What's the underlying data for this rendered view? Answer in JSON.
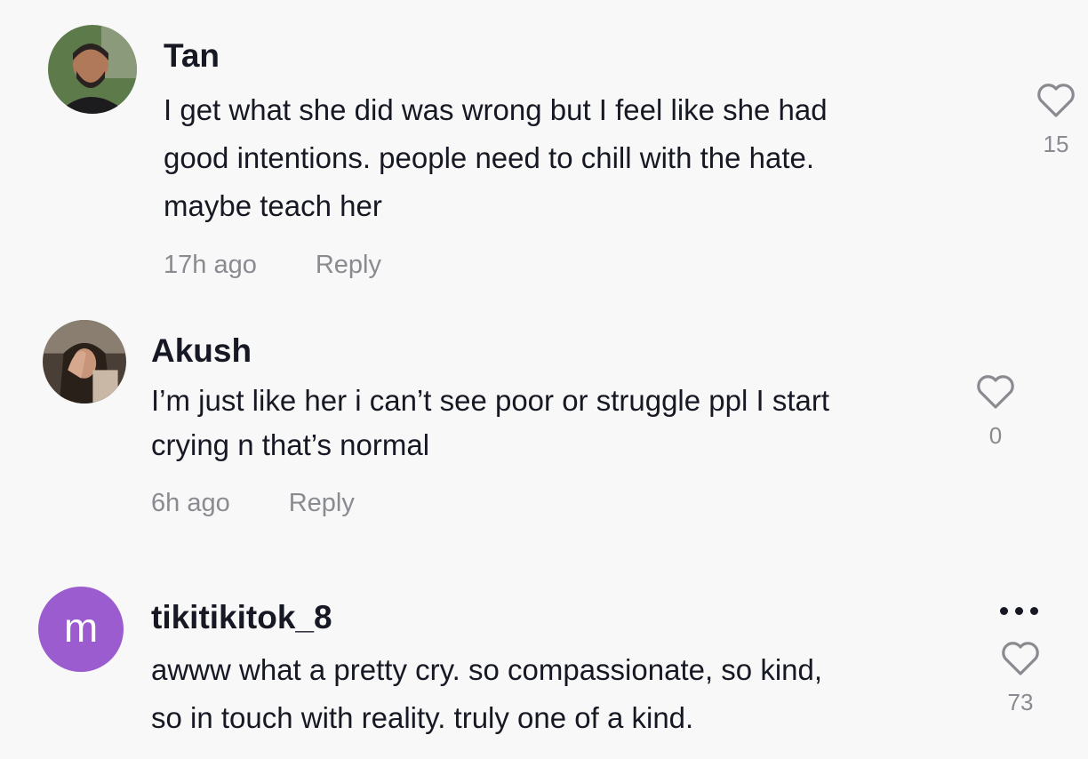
{
  "comments": [
    {
      "username": "Tan",
      "lines": [
        "I get what she did was wrong but I feel like she had",
        "good intentions. people need to chill with the hate.",
        "maybe teach her"
      ],
      "time": "17h ago",
      "reply_label": "Reply",
      "likes": "15",
      "avatar_icon": "profile-photo"
    },
    {
      "username": "Akush",
      "lines": [
        "I’m just like her i can’t see poor or struggle ppl I start",
        "crying n that’s normal"
      ],
      "time": "6h ago",
      "reply_label": "Reply",
      "likes": "0",
      "avatar_icon": "profile-photo"
    },
    {
      "username": "tikitikitok_8",
      "avatar_letter": "m",
      "avatar_color": "#9a5ccf",
      "lines": [
        "awww what a pretty cry. so compassionate, so kind,",
        "so in touch with reality. truly one of a kind."
      ],
      "likes": "73",
      "more_icon": "ellipsis-icon"
    }
  ]
}
